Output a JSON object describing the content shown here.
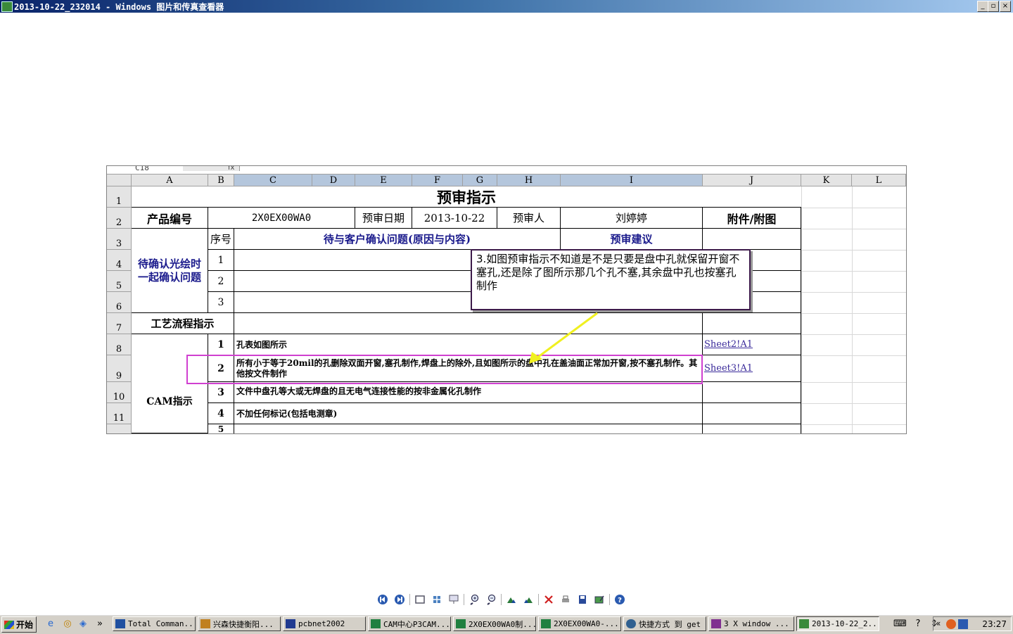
{
  "window": {
    "title": "2013-10-22_232014 - Windows 图片和传真查看器",
    "min_label": "_",
    "max_label": "▫",
    "close_label": "×"
  },
  "sheet": {
    "cell_ref": "C18",
    "fx": "fx",
    "columns": [
      "A",
      "B",
      "C",
      "D",
      "E",
      "F",
      "G",
      "H",
      "I",
      "J",
      "K",
      "L"
    ],
    "rows": [
      "1",
      "2",
      "3",
      "4",
      "5",
      "6",
      "7",
      "8",
      "9",
      "10",
      "11",
      "5"
    ],
    "title": "预审指示",
    "product_no_label": "产品编号",
    "product_no": "2X0EX00WA0",
    "review_date_label": "预审日期",
    "review_date": "2013-10-22",
    "reviewer_label": "预审人",
    "reviewer": "刘婷婷",
    "attach_label": "附件/附图",
    "seq_label": "序号",
    "confirm_header": "待与客户确认问题(原因与内容)",
    "advice_header": "预审建议",
    "pending_group": "待确认光绘时一起确认问题",
    "pending_seq": [
      "1",
      "2",
      "3"
    ],
    "process_label": "工艺流程指示",
    "cam_label": "CAM指示",
    "cam_items": [
      {
        "seq": "1",
        "text": "孔表如图所示",
        "link": "Sheet2!A1"
      },
      {
        "seq": "2",
        "text": "所有小于等于20mil的孔删除双面开窗,塞孔制作,焊盘上的除外,且如图所示的盘中孔在盖油面正常加开窗,按不塞孔制作。其他按文件制作",
        "link": "Sheet3!A1"
      },
      {
        "seq": "3",
        "text": "文件中盘孔等大或无焊盘的且无电气连接性能的按非金属化孔制作",
        "link": ""
      },
      {
        "seq": "4",
        "text": "不加任何标记(包括电测章)",
        "link": ""
      }
    ],
    "note": "3.如图预审指示不知道是不是只要是盘中孔就保留开窗不塞孔,还是除了图所示那几个孔不塞,其余盘中孔也按塞孔制作"
  },
  "taskbar": {
    "start_label": "开始",
    "more_label": "»",
    "tasks": [
      {
        "label": "Total Comman...",
        "color": "#2050a0"
      },
      {
        "label": "兴森快捷衡阳...",
        "color": "#c08020"
      },
      {
        "label": "pcbnet2002",
        "color": "#203a90"
      },
      {
        "label": "CAM中心P3CAM...",
        "color": "#208040"
      },
      {
        "label": "2X0EX00WA0制...",
        "color": "#208040"
      },
      {
        "label": "2X0EX00WA0-...",
        "color": "#208040"
      },
      {
        "label": "快捷方式 到 get",
        "color": "#306090"
      },
      {
        "label": "3 X window ...",
        "color": "#803090"
      },
      {
        "label": "2013-10-22_2...",
        "color": "#3a8a3a"
      }
    ],
    "clock": "23:27",
    "tray_left": "«"
  },
  "colors": {
    "accent_highlight": "#d040d0",
    "arrow": "#f0f020",
    "header_blue": "#1a1a8c"
  }
}
